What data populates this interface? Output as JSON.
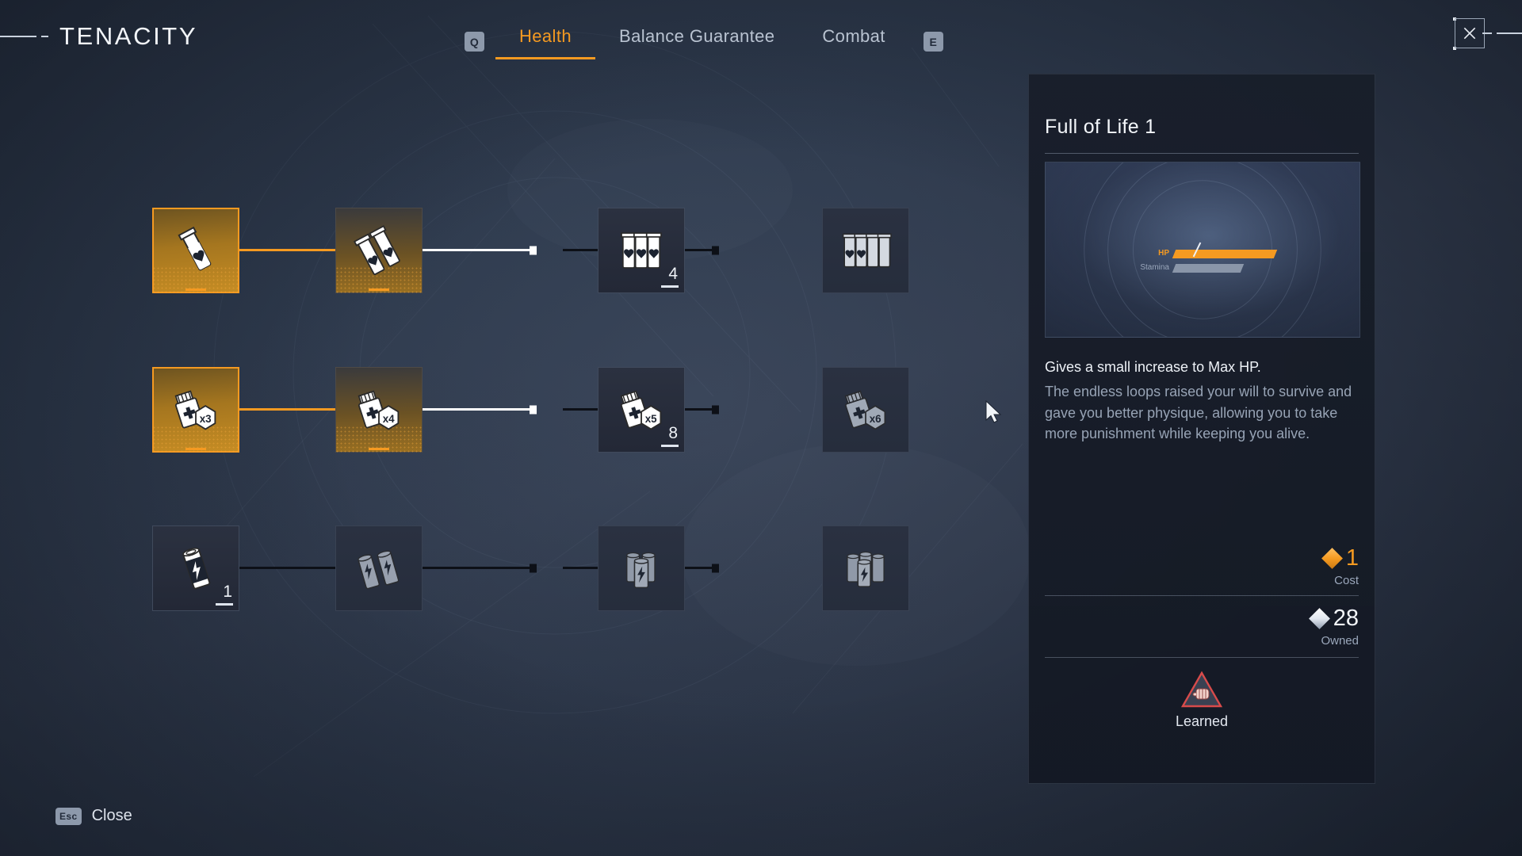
{
  "header": {
    "title": "TENACITY",
    "close_icon": "close-x-icon"
  },
  "tabs": {
    "prev_key": "Q",
    "next_key": "E",
    "items": [
      {
        "label": "Health",
        "active": true
      },
      {
        "label": "Balance Guarantee",
        "active": false
      },
      {
        "label": "Combat",
        "active": false
      }
    ]
  },
  "tree": {
    "rows": [
      {
        "name": "health-vial-row",
        "nodes": [
          {
            "state": "selected",
            "glyph": "vial-1-icon",
            "count": ""
          },
          {
            "state": "learned",
            "glyph": "vial-2-icon",
            "count": ""
          },
          {
            "state": "available",
            "glyph": "vial-3-icon",
            "count": "4"
          },
          {
            "state": "locked",
            "glyph": "vial-4-icon",
            "count": ""
          }
        ],
        "links": [
          "orange",
          "white",
          "dark"
        ]
      },
      {
        "name": "medkit-row",
        "nodes": [
          {
            "state": "selected",
            "glyph": "medkit-x3-icon",
            "count": ""
          },
          {
            "state": "learned",
            "glyph": "medkit-x4-icon",
            "count": ""
          },
          {
            "state": "available",
            "glyph": "medkit-x5-icon",
            "count": "8"
          },
          {
            "state": "locked",
            "glyph": "medkit-x6-icon",
            "count": ""
          }
        ],
        "links": [
          "orange",
          "white",
          "dark"
        ]
      },
      {
        "name": "stamina-battery-row",
        "nodes": [
          {
            "state": "available",
            "glyph": "battery-1-icon",
            "count": "1"
          },
          {
            "state": "locked",
            "glyph": "battery-2-icon",
            "count": ""
          },
          {
            "state": "locked",
            "glyph": "battery-3-icon",
            "count": ""
          },
          {
            "state": "locked",
            "glyph": "battery-4-icon",
            "count": ""
          }
        ],
        "links": [
          "dark",
          "dark",
          "dark"
        ]
      }
    ]
  },
  "panel": {
    "title": "Full of Life 1",
    "preview": {
      "hp_label": "HP",
      "stamina_label": "Stamina"
    },
    "description_main": "Gives a small increase to Max HP.",
    "description_flavor": "The endless loops raised your will to survive and gave you better physique, allowing you to take more punishment while keeping you alive.",
    "cost_value": "1",
    "cost_caption": "Cost",
    "owned_value": "28",
    "owned_caption": "Owned",
    "status_label": "Learned",
    "status_icon": "fist-triangle-icon"
  },
  "footer": {
    "close_key": "Esc",
    "close_label": "Close"
  },
  "colors": {
    "accent": "#f59a21",
    "text": "#e8ecf2",
    "muted": "#97a3b5",
    "panel_bg": "#171d29"
  }
}
